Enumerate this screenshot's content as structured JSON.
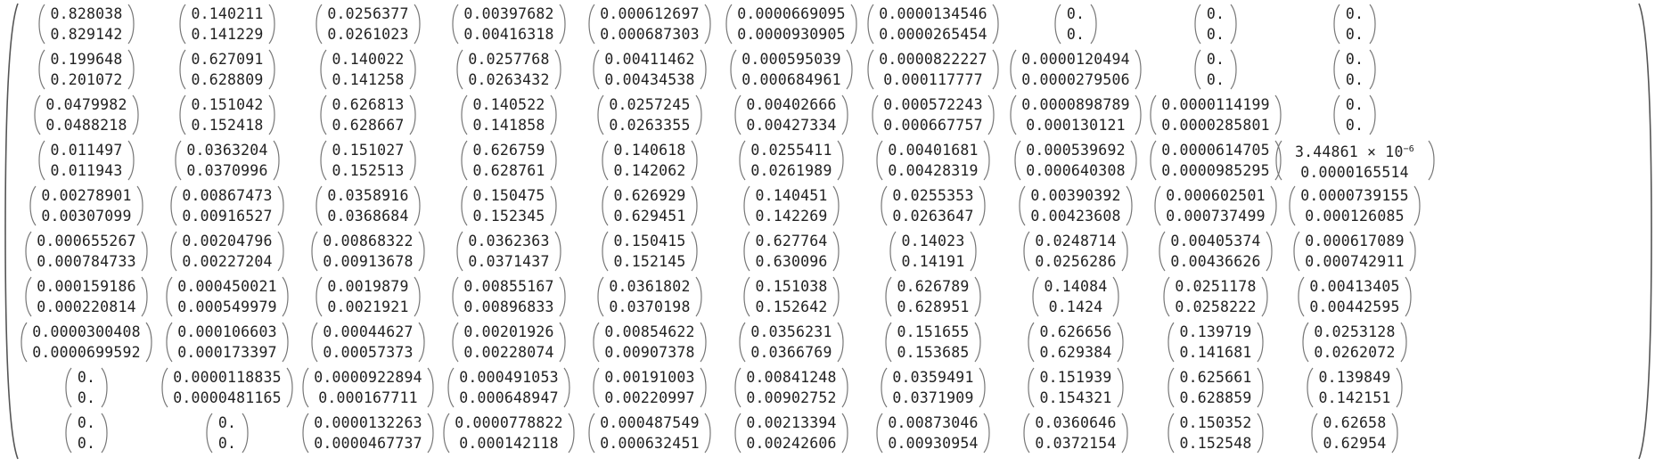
{
  "matrix": {
    "rows": [
      [
        [
          "0.828038",
          "0.829142"
        ],
        [
          "0.140211",
          "0.141229"
        ],
        [
          "0.0256377",
          "0.0261023"
        ],
        [
          "0.00397682",
          "0.00416318"
        ],
        [
          "0.000612697",
          "0.000687303"
        ],
        [
          "0.0000669095",
          "0.0000930905"
        ],
        [
          "0.0000134546",
          "0.0000265454"
        ],
        [
          "0.",
          "0."
        ],
        [
          "0.",
          "0."
        ],
        [
          "0.",
          "0."
        ]
      ],
      [
        [
          "0.199648",
          "0.201072"
        ],
        [
          "0.627091",
          "0.628809"
        ],
        [
          "0.140022",
          "0.141258"
        ],
        [
          "0.0257768",
          "0.0263432"
        ],
        [
          "0.00411462",
          "0.00434538"
        ],
        [
          "0.000595039",
          "0.000684961"
        ],
        [
          "0.0000822227",
          "0.000117777"
        ],
        [
          "0.0000120494",
          "0.0000279506"
        ],
        [
          "0.",
          "0."
        ],
        [
          "0.",
          "0."
        ]
      ],
      [
        [
          "0.0479982",
          "0.0488218"
        ],
        [
          "0.151042",
          "0.152418"
        ],
        [
          "0.626813",
          "0.628667"
        ],
        [
          "0.140522",
          "0.141858"
        ],
        [
          "0.0257245",
          "0.0263355"
        ],
        [
          "0.00402666",
          "0.00427334"
        ],
        [
          "0.000572243",
          "0.000667757"
        ],
        [
          "0.0000898789",
          "0.000130121"
        ],
        [
          "0.0000114199",
          "0.0000285801"
        ],
        [
          "0.",
          "0."
        ]
      ],
      [
        [
          "0.011497",
          "0.011943"
        ],
        [
          "0.0363204",
          "0.0370996"
        ],
        [
          "0.151027",
          "0.152513"
        ],
        [
          "0.626759",
          "0.628761"
        ],
        [
          "0.140618",
          "0.142062"
        ],
        [
          "0.0255411",
          "0.0261989"
        ],
        [
          "0.00401681",
          "0.00428319"
        ],
        [
          "0.000539692",
          "0.000640308"
        ],
        [
          "0.0000614705",
          "0.0000985295"
        ],
        [
          "3.44861 × 10^-6",
          "0.0000165514"
        ]
      ],
      [
        [
          "0.00278901",
          "0.00307099"
        ],
        [
          "0.00867473",
          "0.00916527"
        ],
        [
          "0.0358916",
          "0.0368684"
        ],
        [
          "0.150475",
          "0.152345"
        ],
        [
          "0.626929",
          "0.629451"
        ],
        [
          "0.140451",
          "0.142269"
        ],
        [
          "0.0255353",
          "0.0263647"
        ],
        [
          "0.00390392",
          "0.00423608"
        ],
        [
          "0.000602501",
          "0.000737499"
        ],
        [
          "0.0000739155",
          "0.000126085"
        ]
      ],
      [
        [
          "0.000655267",
          "0.000784733"
        ],
        [
          "0.00204796",
          "0.00227204"
        ],
        [
          "0.00868322",
          "0.00913678"
        ],
        [
          "0.0362363",
          "0.0371437"
        ],
        [
          "0.150415",
          "0.152145"
        ],
        [
          "0.627764",
          "0.630096"
        ],
        [
          "0.14023",
          "0.14191"
        ],
        [
          "0.0248714",
          "0.0256286"
        ],
        [
          "0.00405374",
          "0.00436626"
        ],
        [
          "0.000617089",
          "0.000742911"
        ]
      ],
      [
        [
          "0.000159186",
          "0.000220814"
        ],
        [
          "0.000450021",
          "0.000549979"
        ],
        [
          "0.0019879",
          "0.0021921"
        ],
        [
          "0.00855167",
          "0.00896833"
        ],
        [
          "0.0361802",
          "0.0370198"
        ],
        [
          "0.151038",
          "0.152642"
        ],
        [
          "0.626789",
          "0.628951"
        ],
        [
          "0.14084",
          "0.1424"
        ],
        [
          "0.0251178",
          "0.0258222"
        ],
        [
          "0.00413405",
          "0.00442595"
        ]
      ],
      [
        [
          "0.0000300408",
          "0.0000699592"
        ],
        [
          "0.000106603",
          "0.000173397"
        ],
        [
          "0.00044627",
          "0.00057373"
        ],
        [
          "0.00201926",
          "0.00228074"
        ],
        [
          "0.00854622",
          "0.00907378"
        ],
        [
          "0.0356231",
          "0.0366769"
        ],
        [
          "0.151655",
          "0.153685"
        ],
        [
          "0.626656",
          "0.629384"
        ],
        [
          "0.139719",
          "0.141681"
        ],
        [
          "0.0253128",
          "0.0262072"
        ]
      ],
      [
        [
          "0.",
          "0."
        ],
        [
          "0.0000118835",
          "0.0000481165"
        ],
        [
          "0.0000922894",
          "0.000167711"
        ],
        [
          "0.000491053",
          "0.000648947"
        ],
        [
          "0.00191003",
          "0.00220997"
        ],
        [
          "0.00841248",
          "0.00902752"
        ],
        [
          "0.0359491",
          "0.0371909"
        ],
        [
          "0.151939",
          "0.154321"
        ],
        [
          "0.625661",
          "0.628859"
        ],
        [
          "0.139849",
          "0.142151"
        ]
      ],
      [
        [
          "0.",
          "0."
        ],
        [
          "0.",
          "0."
        ],
        [
          "0.0000132263",
          "0.0000467737"
        ],
        [
          "0.0000778822",
          "0.000142118"
        ],
        [
          "0.000487549",
          "0.000632451"
        ],
        [
          "0.00213394",
          "0.00242606"
        ],
        [
          "0.00873046",
          "0.00930954"
        ],
        [
          "0.0360646",
          "0.0372154"
        ],
        [
          "0.150352",
          "0.152548"
        ],
        [
          "0.62658",
          "0.62954"
        ]
      ]
    ]
  }
}
